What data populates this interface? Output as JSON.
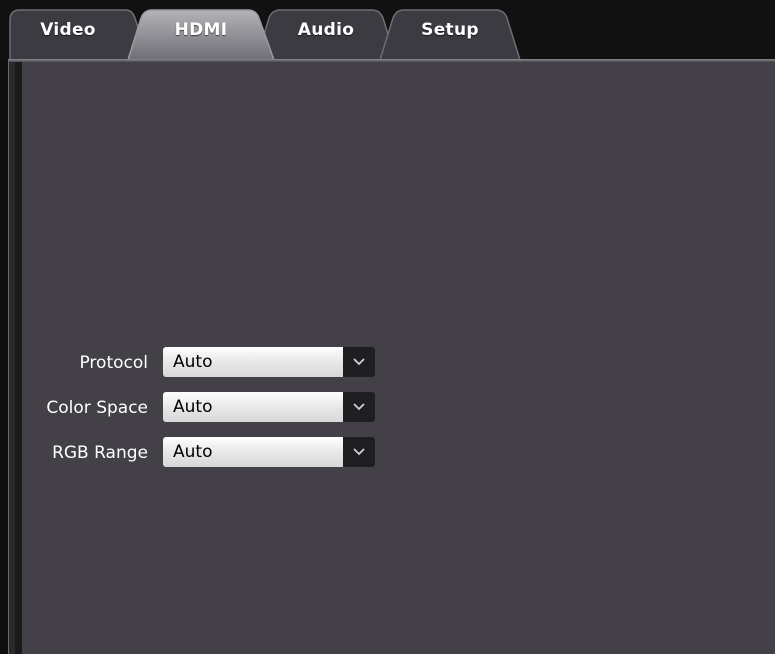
{
  "tabs": [
    {
      "label": "Video",
      "active": false
    },
    {
      "label": "HDMI",
      "active": true
    },
    {
      "label": "Audio",
      "active": false
    },
    {
      "label": "Setup",
      "active": false
    }
  ],
  "settings": [
    {
      "label": "Protocol",
      "value": "Auto"
    },
    {
      "label": "Color Space",
      "value": "Auto"
    },
    {
      "label": "RGB Range",
      "value": "Auto"
    }
  ],
  "colors": {
    "panel_bg": "#434047",
    "tab_inactive": "#3a3a40",
    "tab_active": "#8e8e93",
    "dropdown_arrow_bg": "#1f1f22"
  },
  "icons": {
    "dropdown": "chevron-down-icon"
  }
}
